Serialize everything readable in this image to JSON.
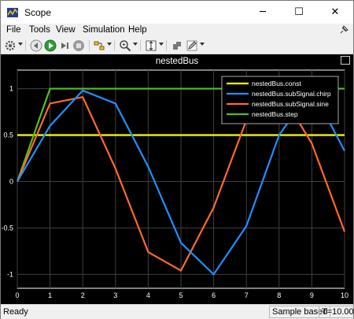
{
  "window": {
    "title": "Scope",
    "minimize": "─",
    "maximize": "☐",
    "close": "✕"
  },
  "menu": [
    "File",
    "Tools",
    "View",
    "Simulation",
    "Help"
  ],
  "toolbar_icons": [
    "settings-icon",
    "step-back-icon",
    "run-icon",
    "step-forward-icon",
    "stop-icon",
    "signal-selector-icon",
    "zoom-icon",
    "scale-axes-icon",
    "highlight-block-icon",
    "edit-icon"
  ],
  "colors": {
    "plot_bg": "#000000",
    "axes_fg": "#ffffff",
    "grid": "#404040",
    "const": "#ffff00",
    "chirp": "#1e90ff",
    "sine": "#ff6a2a",
    "step": "#4ec21c"
  },
  "status": {
    "left": "Ready",
    "mode": "Sample based",
    "time": "T=10.000"
  },
  "chart_data": {
    "type": "line",
    "title": "nestedBus",
    "xlim": [
      0,
      10
    ],
    "ylim": [
      -1.15,
      1.2
    ],
    "xticks": [
      "0",
      "1",
      "2",
      "3",
      "4",
      "5",
      "6",
      "7",
      "8",
      "9",
      "10"
    ],
    "yticks": [
      "1",
      "0.5",
      "0",
      "-0.5",
      "-1"
    ],
    "grid": true,
    "legend_position": "top-right",
    "x": [
      0,
      1,
      2,
      3,
      4,
      5,
      6,
      7,
      8,
      9,
      10
    ],
    "series": [
      {
        "name": "nestedBus.const",
        "color": "#ffff00",
        "values": [
          0.5,
          0.5,
          0.5,
          0.5,
          0.5,
          0.5,
          0.5,
          0.5,
          0.5,
          0.5,
          0.5
        ]
      },
      {
        "name": "nestedBus.subSignal.chirp",
        "color": "#1e90ff",
        "values": [
          0,
          0.6,
          0.98,
          0.84,
          0.16,
          -0.66,
          -1.0,
          -0.48,
          0.5,
          1.0,
          0.33
        ]
      },
      {
        "name": "nestedBus.subSignal.sine",
        "color": "#ff6a2a",
        "values": [
          0,
          0.84,
          0.91,
          0.14,
          -0.76,
          -0.96,
          -0.28,
          0.66,
          0.99,
          0.41,
          -0.54
        ]
      },
      {
        "name": "nestedBus.step",
        "color": "#4ec21c",
        "values": [
          0,
          1,
          1,
          1,
          1,
          1,
          1,
          1,
          1,
          1,
          1
        ]
      }
    ]
  }
}
